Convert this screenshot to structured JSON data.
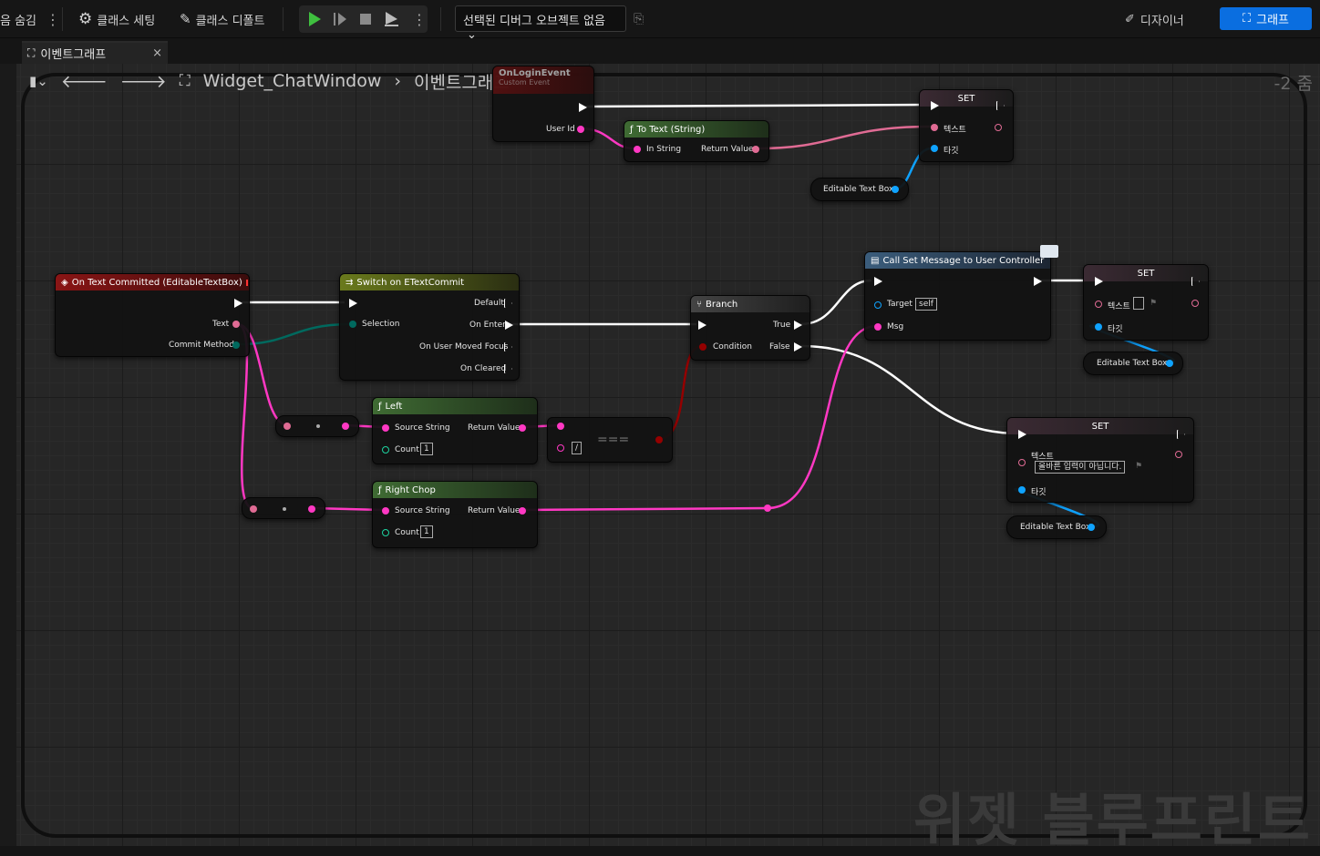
{
  "toolbar": {
    "hide_label": "음 숨김",
    "class_settings": "클래스 세팅",
    "class_defaults": "클래스 디폴트",
    "debug_object": "선택된 디버그 오브젝트 없음",
    "designer": "디자이너",
    "graph": "그래프"
  },
  "tab": {
    "label": "이벤트그래프",
    "close": "×"
  },
  "breadcrumb": {
    "widget": "Widget_ChatWindow",
    "graph": "이벤트그래프"
  },
  "zoom": "-2 줌",
  "watermark": "위젯 블루프린트",
  "nodes": {
    "login_event": {
      "title": "OnLoginEvent",
      "subtitle": "Custom Event",
      "pin_userid": "User Id"
    },
    "to_text": {
      "title": "To Text (String)",
      "in": "In String",
      "out": "Return Value"
    },
    "set_top": {
      "title": "SET",
      "text": "텍스트",
      "target": "타깃"
    },
    "etb_top": {
      "label": "Editable Text Box"
    },
    "on_text_committed": {
      "title": "On Text Committed (EditableTextBox)",
      "text": "Text",
      "commit": "Commit Method"
    },
    "switch": {
      "title": "Switch on ETextCommit",
      "selection": "Selection",
      "default": "Default",
      "on_enter": "On Enter",
      "on_focus": "On User Moved Focus",
      "on_cleared": "On Cleared"
    },
    "branch": {
      "title": "Branch",
      "condition": "Condition",
      "true": "True",
      "false": "False"
    },
    "call_set_message": {
      "title": "Call Set Message to User Controller",
      "target": "Target",
      "target_val": "self",
      "msg": "Msg"
    },
    "set_right1": {
      "title": "SET",
      "text": "텍스트",
      "target": "타깃"
    },
    "etb_right1": {
      "label": "Editable Text Box"
    },
    "set_right2": {
      "title": "SET",
      "text": "텍스트",
      "text_val": "올바른 입력이 아닙니다.",
      "target": "타깃"
    },
    "etb_right2": {
      "label": "Editable Text Box"
    },
    "left": {
      "title": "Left",
      "source": "Source String",
      "count": "Count",
      "count_val": "1",
      "ret": "Return Value"
    },
    "equal": {
      "symbol": "===",
      "value": "/"
    },
    "right_chop": {
      "title": "Right Chop",
      "source": "Source String",
      "count": "Count",
      "count_val": "1",
      "ret": "Return Value"
    }
  },
  "colors": {
    "string_pin": "#ff38c3",
    "object_pin": "#0fa3ff",
    "exec": "#ffffff",
    "bool_pin": "#940000",
    "enum_pin": "#00695e",
    "text_pin": "#e06b94",
    "accent_blue": "#0a6ee0"
  }
}
